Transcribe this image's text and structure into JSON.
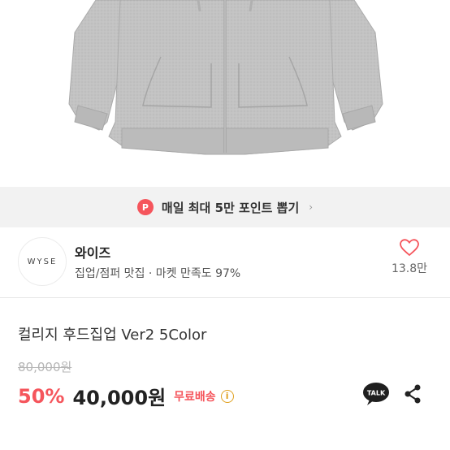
{
  "promo": {
    "badge": "P",
    "text": "매일 최대 5만 포인트 뽑기",
    "chevron": "›"
  },
  "store": {
    "logo_text": "WYSE",
    "name": "와이즈",
    "description": "집업/점퍼 맛집 · 마켓 만족도 97%",
    "likes": "13.8만"
  },
  "product": {
    "title": "컬리지 후드집업 Ver2 5Color",
    "original_price": "80,000원",
    "discount": "50%",
    "price": "40,000원",
    "shipping": "무료배송",
    "info_icon": "i",
    "talk_label": "TALK"
  },
  "icons": {
    "promo": "point-coin-icon",
    "like": "heart-icon",
    "info": "info-icon",
    "talk": "kakaotalk-icon",
    "share": "share-icon"
  },
  "colors": {
    "accent": "#f5555c",
    "info": "#e0a01f",
    "hoodie": "#bdbdbd"
  }
}
